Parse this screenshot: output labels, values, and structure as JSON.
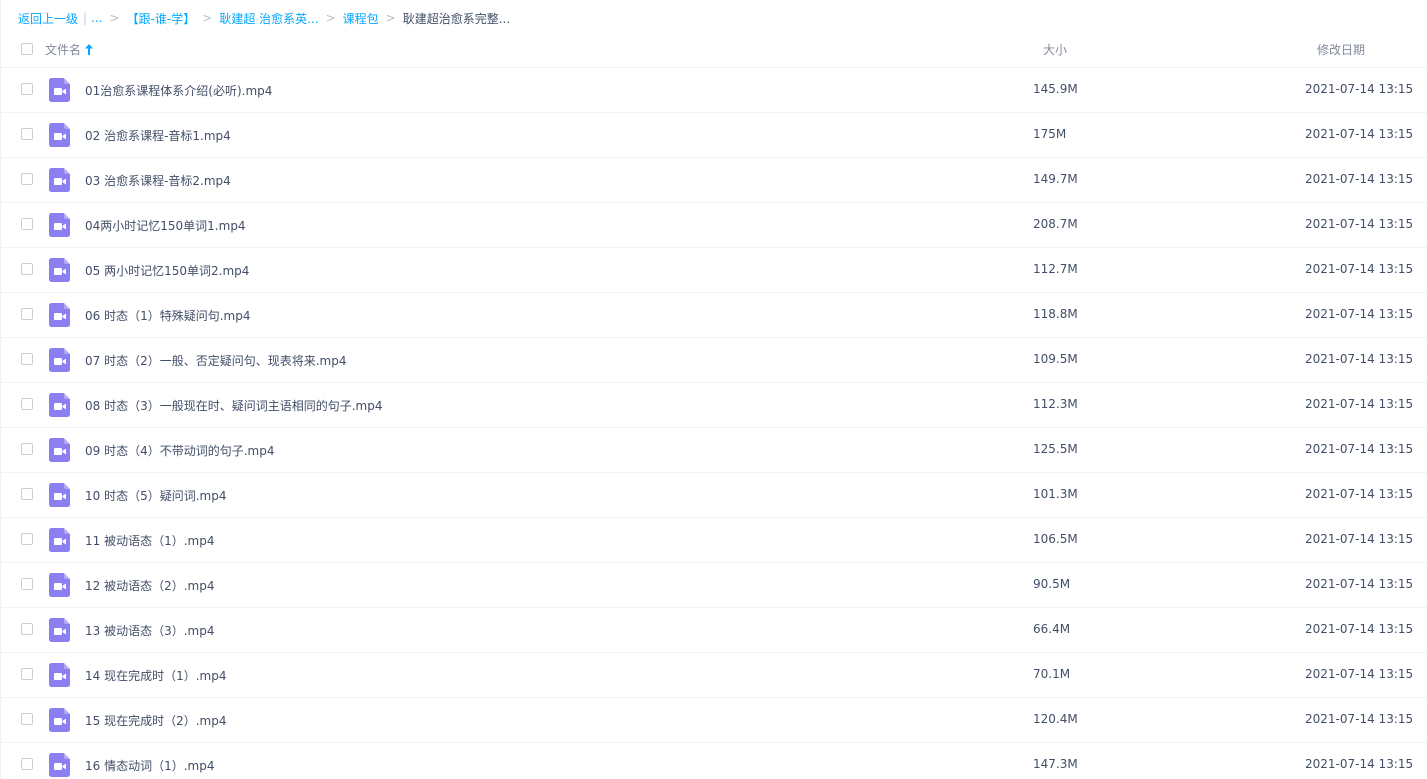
{
  "breadcrumb": {
    "back": "返回上一级",
    "ellipsis": "...",
    "items": [
      "【跟-谁-学】",
      "耿建超 治愈系英...",
      "课程包"
    ],
    "current": "耿建超治愈系完整..."
  },
  "header": {
    "name": "文件名",
    "size": "大小",
    "date": "修改日期"
  },
  "colors": {
    "accent": "#06a7ff",
    "video_icon": "#8b7ff2"
  },
  "files": [
    {
      "name": "01治愈系课程体系介绍(必听).mp4",
      "size": "145.9M",
      "date": "2021-07-14 13:15"
    },
    {
      "name": "02 治愈系课程-音标1.mp4",
      "size": "175M",
      "date": "2021-07-14 13:15"
    },
    {
      "name": "03 治愈系课程-音标2.mp4",
      "size": "149.7M",
      "date": "2021-07-14 13:15"
    },
    {
      "name": "04两小时记忆150单词1.mp4",
      "size": "208.7M",
      "date": "2021-07-14 13:15"
    },
    {
      "name": "05 两小时记忆150单词2.mp4",
      "size": "112.7M",
      "date": "2021-07-14 13:15"
    },
    {
      "name": "06 时态（1）特殊疑问句.mp4",
      "size": "118.8M",
      "date": "2021-07-14 13:15"
    },
    {
      "name": "07 时态（2）一般、否定疑问句、现表将来.mp4",
      "size": "109.5M",
      "date": "2021-07-14 13:15"
    },
    {
      "name": "08 时态（3）一般现在时、疑问词主语相同的句子.mp4",
      "size": "112.3M",
      "date": "2021-07-14 13:15"
    },
    {
      "name": "09 时态（4）不带动词的句子.mp4",
      "size": "125.5M",
      "date": "2021-07-14 13:15"
    },
    {
      "name": "10 时态（5）疑问词.mp4",
      "size": "101.3M",
      "date": "2021-07-14 13:15"
    },
    {
      "name": "11 被动语态（1）.mp4",
      "size": "106.5M",
      "date": "2021-07-14 13:15"
    },
    {
      "name": "12 被动语态（2）.mp4",
      "size": "90.5M",
      "date": "2021-07-14 13:15"
    },
    {
      "name": "13 被动语态（3）.mp4",
      "size": "66.4M",
      "date": "2021-07-14 13:15"
    },
    {
      "name": "14 现在完成时（1）.mp4",
      "size": "70.1M",
      "date": "2021-07-14 13:15"
    },
    {
      "name": "15 现在完成时（2）.mp4",
      "size": "120.4M",
      "date": "2021-07-14 13:15"
    },
    {
      "name": "16 情态动词（1）.mp4",
      "size": "147.3M",
      "date": "2021-07-14 13:15"
    }
  ]
}
